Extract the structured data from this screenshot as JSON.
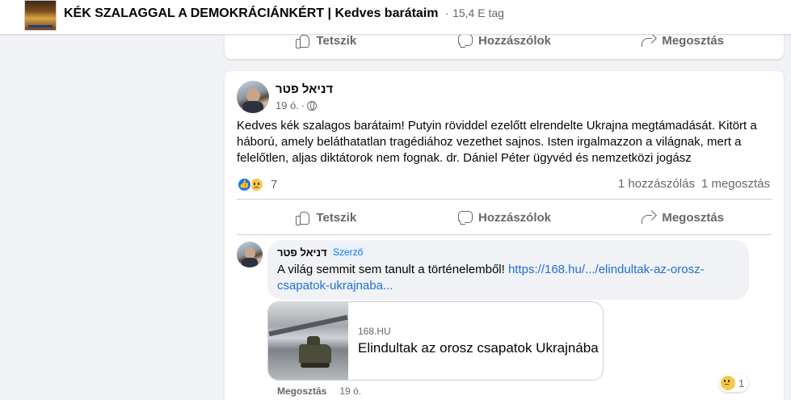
{
  "group": {
    "title": "KÉK SZALAGGAL A DEMOKRÁCIÁNKÉRT | Kedves barátaim",
    "separator": "·",
    "members": "15,4 E tag"
  },
  "actions": {
    "like": "Tetszik",
    "comment": "Hozzászólok",
    "share": "Megosztás"
  },
  "post": {
    "author": "דניאל פטר",
    "time": "19 ó.",
    "dot": "·",
    "text": "Kedves kék szalagos barátaim! Putyin röviddel ezelőtt elrendelte Ukrajna megtámadását. Kitört a háború, amely beláthatatlan tragédiához vezethet sajnos. Isten irgalmazzon a világnak, mert a felelőtlen, aljas diktátorok nem fognak. dr. Dániel Péter ügyvéd és nemzetközi jogász",
    "reaction_count": "7",
    "comments_count": "1 hozzászólás",
    "shares_count": "1 megosztás"
  },
  "comment": {
    "author": "דניאל פטר",
    "badge": "Szerző",
    "text": "A világ semmit sem tanult a történelemből!",
    "link_text": "https://168.hu/.../elindultak-az-orosz-csapatok-ukrajnaba...",
    "preview": {
      "domain": "168.HU",
      "title": "Elindultak az orosz csapatok Ukrajnába"
    },
    "footer_share": "Megosztás",
    "footer_time": "19 ó.",
    "reaction_count": "1"
  },
  "colors": {
    "accent": "#1877f2",
    "link": "#216fdb",
    "muted": "#65676b"
  }
}
